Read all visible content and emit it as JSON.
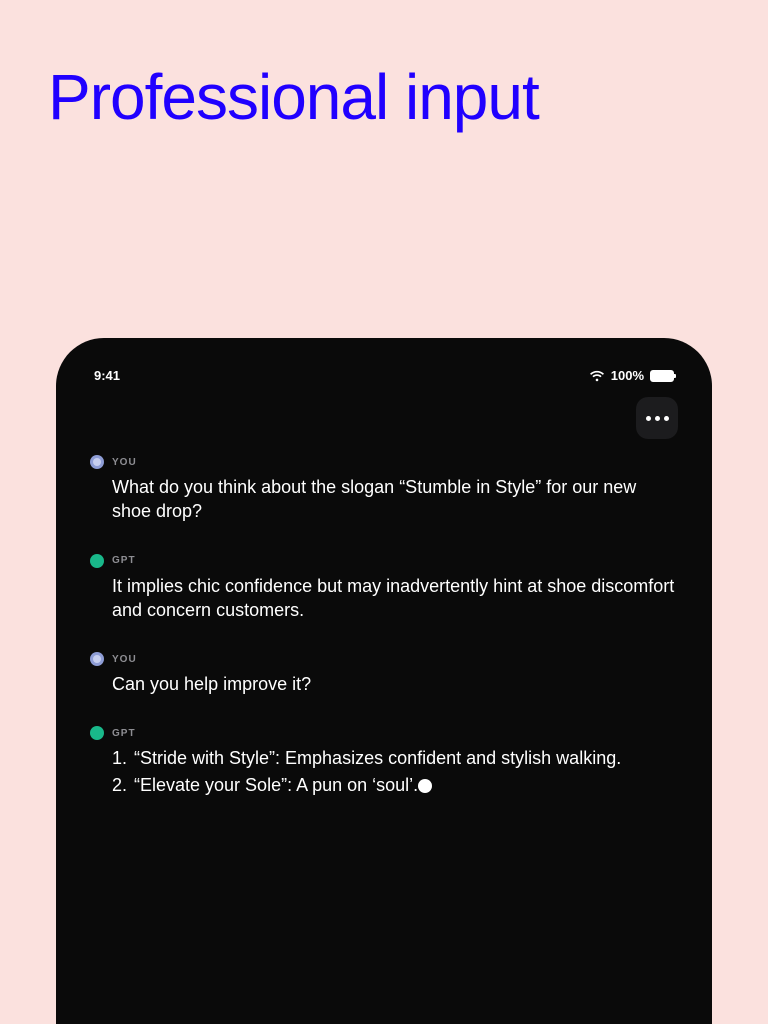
{
  "headline": "Professional input",
  "statusBar": {
    "time": "9:41",
    "batteryText": "100%"
  },
  "speakers": {
    "user": "YOU",
    "gpt": "GPT"
  },
  "messages": {
    "m1": "What do you think about the slogan “Stumble in Style” for our new shoe drop?",
    "m2": "It implies chic confidence but may inadvertently hint at shoe discomfort and concern customers.",
    "m3": "Can you help improve it?",
    "m4_item1": "“Stride with Style”: Emphasizes confident and stylish walking.",
    "m4_item2": "“Elevate your Sole”: A pun on ‘soul’."
  }
}
